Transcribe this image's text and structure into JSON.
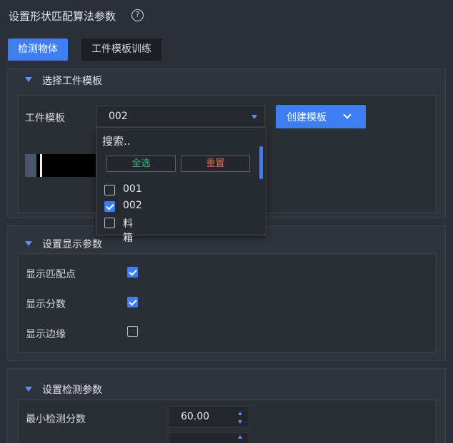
{
  "title": "设置形状匹配算法参数",
  "help_icon": "?",
  "tabs": [
    {
      "label": "检测物体",
      "active": true
    },
    {
      "label": "工件模板训练",
      "active": false
    }
  ],
  "section_template": {
    "header": "选择工件模板",
    "field_label": "工件模板",
    "selected_value": "002",
    "create_button": "创建模板",
    "dropdown": {
      "search_placeholder": "搜索..",
      "select_all": "全选",
      "reset": "重置",
      "options": [
        {
          "label": "001",
          "checked": false
        },
        {
          "label": "002",
          "checked": true
        },
        {
          "label": "料箱",
          "checked": false
        }
      ]
    }
  },
  "section_display": {
    "header": "设置显示参数",
    "items": [
      {
        "label": "显示匹配点",
        "checked": true
      },
      {
        "label": "显示分数",
        "checked": true
      },
      {
        "label": "显示边缘",
        "checked": false
      }
    ]
  },
  "section_detect": {
    "header": "设置检测参数",
    "min_score_label": "最小检测分数",
    "min_score_value": "60.00"
  },
  "colors": {
    "accent": "#3f7ef2",
    "background": "#2b2f37",
    "select_all_text": "#3fb47a",
    "reset_text": "#e4654e"
  }
}
